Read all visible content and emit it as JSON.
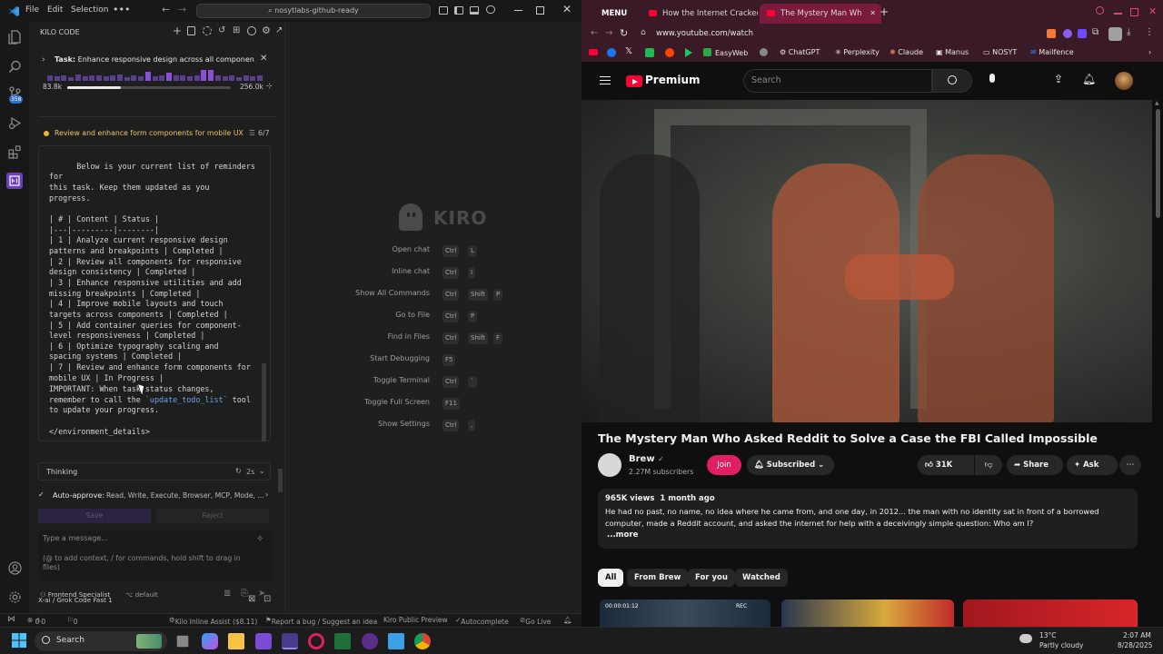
{
  "vscode": {
    "menu": [
      "File",
      "Edit",
      "Selection"
    ],
    "command_center": "nosytlabs-github-ready",
    "activity_badge": "358",
    "kilo": {
      "title": "KILO CODE",
      "task_label": "Task:",
      "task_text": "Enhance responsive design across all component...",
      "tokens_used": "83.8k",
      "tokens_total": "256.0k",
      "token_progress": 0.33,
      "todo_current": "Review and enhance form components for mobile UX",
      "todo_count": "6/7",
      "message_lines": "Below is your current list of reminders for\nthis task. Keep them updated as you\nprogress.\n\n| # | Content | Status |\n|---|---------|--------|\n| 1 | Analyze current responsive design\npatterns and breakpoints | Completed |\n| 2 | Review all components for responsive\ndesign consistency | Completed |\n| 3 | Enhance responsive utilities and add\nmissing breakpoints | Completed |\n| 4 | Improve mobile layouts and touch\ntargets across components | Completed |\n| 5 | Add container queries for component-\nlevel responsiveness | Completed |\n| 6 | Optimize typography scaling and\nspacing systems | Completed |\n| 7 | Review and enhance form components for\nmobile UX | In Progress |",
      "important_pre": "IMPORTANT: When task status changes,\nremember to call the ",
      "important_code": "`update_todo_list`",
      "important_post": " tool\nto update your progress.",
      "env_close": "</environment_details>",
      "thinking_label": "Thinking",
      "thinking_time": "2s",
      "auto_approve_label": "Auto-approve:",
      "auto_approve_list": "Read, Write, Execute, Browser, MCP, Mode, ...",
      "save_label": "Save",
      "reject_label": "Reject",
      "input_placeholder": "Type a message...",
      "input_hint": "(@ to add context, / for commands, hold shift to drag in files)",
      "mode": "Frontend Specialist",
      "profile": "default",
      "model": "X-ai / Grok Code Fast 1"
    },
    "editor": {
      "logo_text": "KIRO",
      "shortcuts": [
        {
          "label": "Open chat",
          "keys": [
            "Ctrl",
            "L"
          ]
        },
        {
          "label": "Inline chat",
          "keys": [
            "Ctrl",
            "I"
          ]
        },
        {
          "label": "Show All Commands",
          "keys": [
            "Ctrl",
            "Shift",
            "P"
          ]
        },
        {
          "label": "Go to File",
          "keys": [
            "Ctrl",
            "P"
          ]
        },
        {
          "label": "Find in Files",
          "keys": [
            "Ctrl",
            "Shift",
            "F"
          ]
        },
        {
          "label": "Start Debugging",
          "keys": [
            "F5"
          ]
        },
        {
          "label": "Toggle Terminal",
          "keys": [
            "Ctrl",
            "`"
          ]
        },
        {
          "label": "Toggle Full Screen",
          "keys": [
            "F11"
          ]
        },
        {
          "label": "Show Settings",
          "keys": [
            "Ctrl",
            ","
          ]
        }
      ]
    },
    "status": {
      "errors": "0",
      "warnings": "0",
      "ports": "0",
      "kilo_inline": "Kilo Inline Assist ($8.11)",
      "bug": "Report a bug / Suggest an idea",
      "preview": "Kiro Public Preview",
      "autocomplete": "Autocomplete",
      "golive": "Go Live"
    }
  },
  "browser": {
    "tabs": [
      {
        "label": "MENU",
        "active": false
      },
      {
        "label": "How the Internet Cracked",
        "active": false
      },
      {
        "label": "The Mystery Man Wh",
        "active": true
      }
    ],
    "url": "www.youtube.com/watch",
    "bookmarks": [
      "EasyWeb",
      "ChatGPT",
      "Perplexity",
      "Claude",
      "Manus",
      "NOSYT",
      "Mailfence"
    ],
    "yt": {
      "brand": "Premium",
      "search_placeholder": "Search",
      "title": "The Mystery Man Who Asked Reddit to Solve a Case the FBI Called Impossible",
      "channel": "Brew",
      "subscribers": "2.27M subscribers",
      "join": "Join",
      "subscribed": "Subscribed",
      "likes": "31K",
      "share": "Share",
      "ask": "Ask",
      "views": "965K views",
      "age": "1 month ago",
      "description": "He had no past, no name, no idea where he came from, and one day, in 2012... the man with no identity sat in front of a borrowed computer, made a Reddit account, and asked the internet for help with a deceivingly simple question: Who am I?",
      "more": "...more",
      "chips": [
        "All",
        "From Brew",
        "For you",
        "Watched"
      ],
      "thumb_time": "00:00:01:12",
      "thumb_rec": "REC"
    }
  },
  "taskbar": {
    "search": "Search",
    "temp": "13°C",
    "weather": "Partly cloudy",
    "time": "2:07 AM",
    "date": "8/28/2025"
  },
  "colors": {
    "accent": "#8a4fd9",
    "yt_red": "#ff0033",
    "join_pink": "#e11d63",
    "browser_chrome": "#3a1a26"
  }
}
